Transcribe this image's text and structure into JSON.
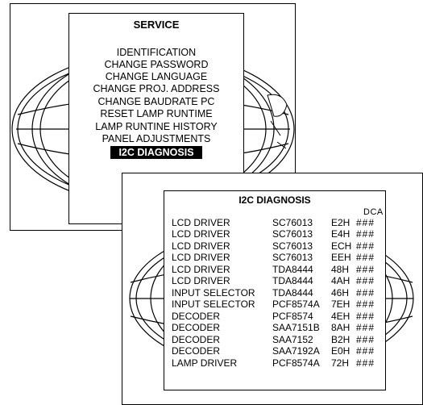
{
  "service_menu": {
    "title": "SERVICE",
    "items": [
      {
        "label": "IDENTIFICATION"
      },
      {
        "label": "CHANGE PASSWORD"
      },
      {
        "label": "CHANGE LANGUAGE"
      },
      {
        "label": "CHANGE PROJ. ADDRESS"
      },
      {
        "label": "CHANGE BAUDRATE PC"
      },
      {
        "label": "RESET LAMP RUNTIME"
      },
      {
        "label": "LAMP RUNTINE HISTORY"
      },
      {
        "label": "PANEL ADJUSTMENTS"
      },
      {
        "label": "I2C DIAGNOSIS"
      }
    ],
    "selected_item": "I2C DIAGNOSIS"
  },
  "i2c_diagnosis": {
    "title": "I2C DIAGNOSIS",
    "column_header": "DCA",
    "rows": [
      {
        "device": "LCD DRIVER",
        "chip": "SC76013",
        "address": "E2H",
        "status": "###"
      },
      {
        "device": "LCD DRIVER",
        "chip": "SC76013",
        "address": "E4H",
        "status": "###"
      },
      {
        "device": "LCD DRIVER",
        "chip": "SC76013",
        "address": "ECH",
        "status": "###"
      },
      {
        "device": "LCD DRIVER",
        "chip": "SC76013",
        "address": "EEH",
        "status": "###"
      },
      {
        "device": "LCD DRIVER",
        "chip": "TDA8444",
        "address": "48H",
        "status": "###"
      },
      {
        "device": "LCD DRIVER",
        "chip": "TDA8444",
        "address": "4AH",
        "status": "###"
      },
      {
        "device": "INPUT SELECTOR",
        "chip": "TDA8444",
        "address": "46H",
        "status": "###"
      },
      {
        "device": "INPUT SELECTOR",
        "chip": "PCF8574A",
        "address": "7EH",
        "status": "###"
      },
      {
        "device": "DECODER",
        "chip": "PCF8574",
        "address": "4EH",
        "status": "###"
      },
      {
        "device": "DECODER",
        "chip": "SAA7151B",
        "address": "8AH",
        "status": "###"
      },
      {
        "device": "DECODER",
        "chip": "SAA7152",
        "address": "B2H",
        "status": "###"
      },
      {
        "device": "DECODER",
        "chip": "SAA7192A",
        "address": "E0H",
        "status": "###"
      },
      {
        "device": "LAMP DRIVER",
        "chip": "PCF8574A",
        "address": "72H",
        "status": "###"
      }
    ]
  },
  "colors": {
    "background": "#ffffff",
    "line": "#000000",
    "highlight_bg": "#000000",
    "highlight_text": "#ffffff"
  },
  "icons": [
    "globe-icon",
    "lamp-icon"
  ]
}
